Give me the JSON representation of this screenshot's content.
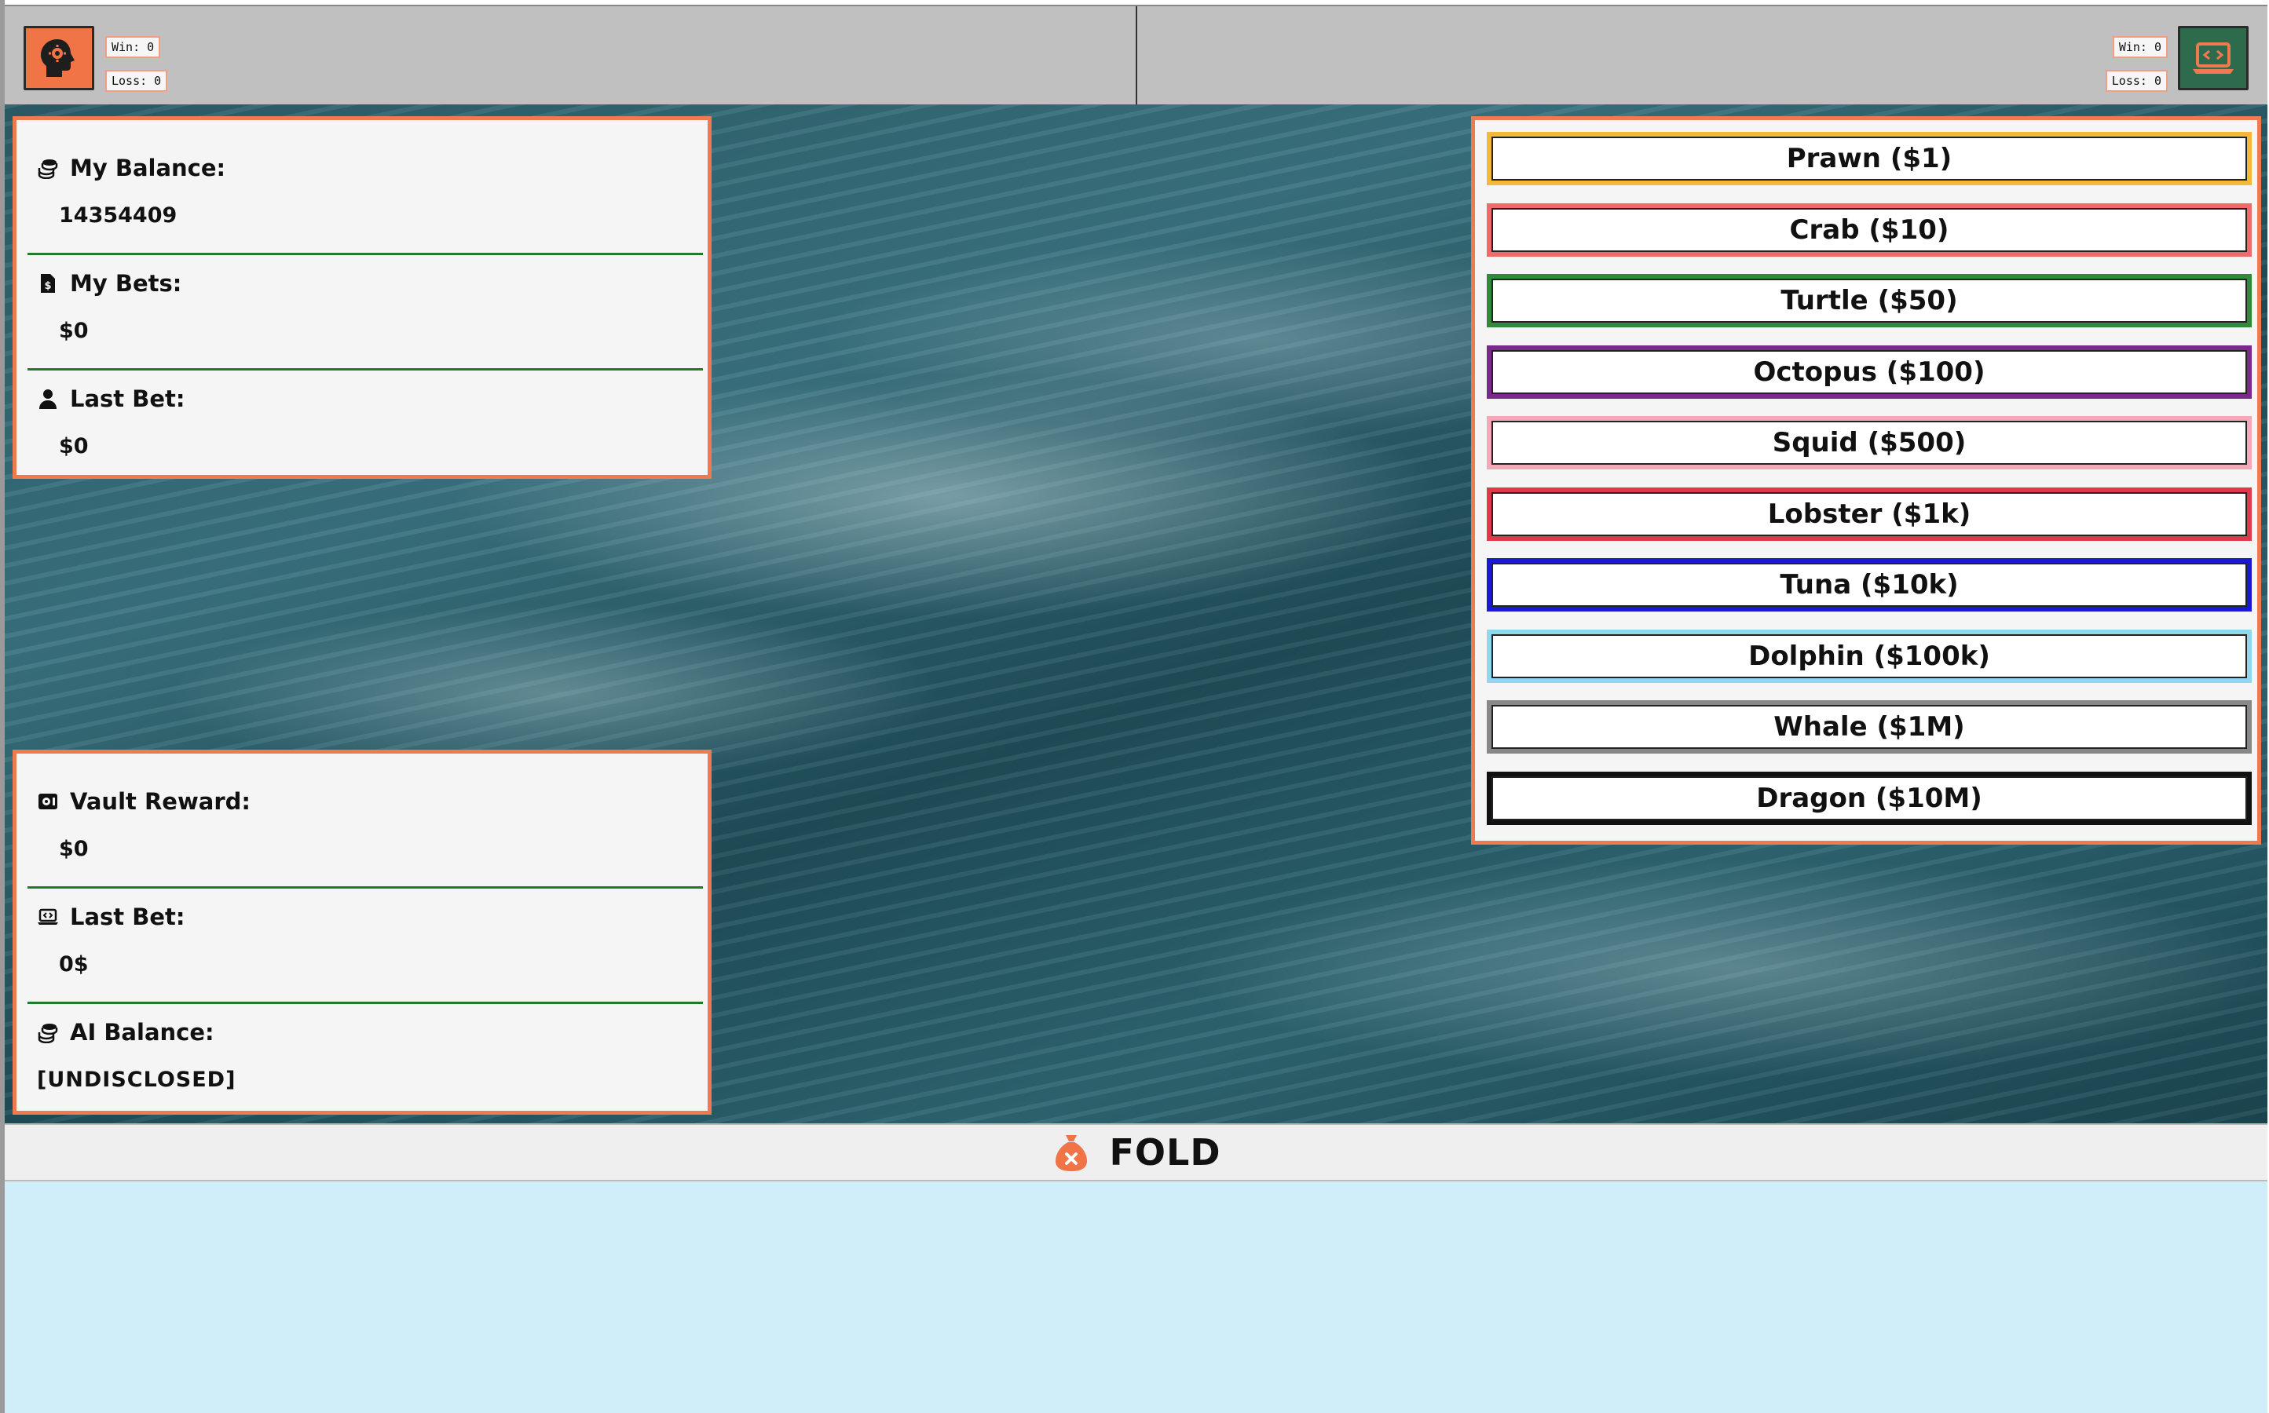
{
  "player": {
    "win_label": "Win: 0",
    "loss_label": "Loss: 0"
  },
  "ai": {
    "win_label": "Win: 0",
    "loss_label": "Loss: 0"
  },
  "player_panel": {
    "balance_label": "My Balance:",
    "balance_value": "14354409",
    "bets_label": "My Bets:",
    "bets_value": "$0",
    "last_bet_label": "Last Bet:",
    "last_bet_value": "$0"
  },
  "ai_panel": {
    "vault_label": "Vault Reward:",
    "vault_value": "$0",
    "last_bet_label": "Last Bet:",
    "last_bet_value": "0$",
    "balance_label": "AI Balance:",
    "balance_value": "[UNDISCLOSED]"
  },
  "bet_options": [
    {
      "label": "Prawn ($1)",
      "color": "#f5b93a"
    },
    {
      "label": "Crab ($10)",
      "color": "#f06a6a"
    },
    {
      "label": "Turtle ($50)",
      "color": "#2f8a3a"
    },
    {
      "label": "Octopus ($100)",
      "color": "#7a2a8a"
    },
    {
      "label": "Squid ($500)",
      "color": "#f4a8b8"
    },
    {
      "label": "Lobster ($1k)",
      "color": "#e0394a"
    },
    {
      "label": "Tuna ($10k)",
      "color": "#1a1ad0"
    },
    {
      "label": "Dolphin ($100k)",
      "color": "#8fd8f0"
    },
    {
      "label": "Whale ($1M)",
      "color": "#888888"
    },
    {
      "label": "Dragon ($10M)",
      "color": "#111111"
    }
  ],
  "fold": {
    "label": "FOLD"
  },
  "colors": {
    "accent": "#f07a50",
    "divider": "#1f7a2a",
    "player_avatar": "#f07446",
    "ai_avatar": "#2e6b4c",
    "lower_area": "#cfeefa"
  },
  "icons": {
    "player_avatar": "head-gear-icon",
    "ai_avatar": "laptop-code-icon",
    "balance": "coins-icon",
    "bets": "dollar-file-icon",
    "last_bet_player": "user-icon",
    "vault": "vault-icon",
    "last_bet_ai": "laptop-code-icon",
    "ai_balance": "coins-icon",
    "fold": "money-bag-x-icon"
  }
}
